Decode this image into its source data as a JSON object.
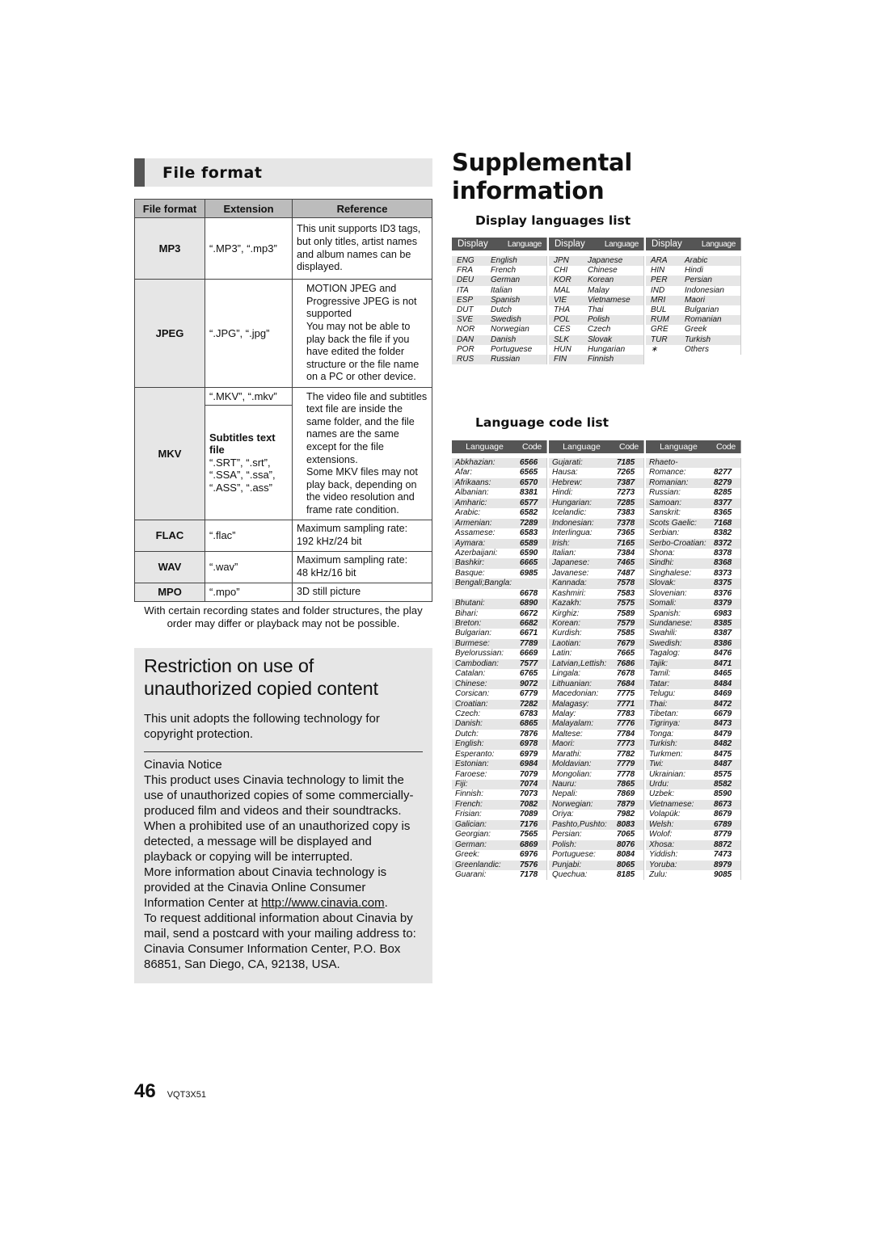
{
  "file_format": {
    "section_title": "File format",
    "headers": [
      "File format",
      "Extension",
      "Reference"
    ],
    "rows": [
      {
        "format": "MP3",
        "extension": "“.MP3”, “.mp3”",
        "reference": "This unit supports ID3 tags, but only titles, artist names and album names can be displayed."
      },
      {
        "format": "JPEG",
        "extension": "“.JPG”, “.jpg”",
        "reference": "MOTION JPEG and Progressive JPEG is not supported\nYou may not be able to play back the file if you have edited the folder structure or the file name on a PC or other device."
      },
      {
        "format": "MKV",
        "extension": "“.MKV”, “.mkv”",
        "subtitle_label": "Subtitles text file",
        "subtitle_extensions": "“.SRT”, “.srt”,\n“.SSA”, “.ssa”,\n“.ASS”, “.ass”",
        "reference": "The video file and subtitles text file are inside the same folder, and the file names are the same except for the file extensions.\nSome MKV files may not play back, depending on the video resolution and frame rate condition."
      },
      {
        "format": "FLAC",
        "extension": "“.flac”",
        "reference": "Maximum sampling rate:\n192 kHz/24 bit"
      },
      {
        "format": "WAV",
        "extension": "“.wav”",
        "reference": "Maximum sampling rate:\n48 kHz/16 bit"
      },
      {
        "format": "MPO",
        "extension": "“.mpo”",
        "reference": "3D still picture"
      }
    ],
    "note": "With certain recording states and folder structures, the play order may differ or playback may not be possible."
  },
  "restriction": {
    "title": "Restriction on use of unauthorized copied content",
    "intro": "This unit adopts the following technology for copyright protection.",
    "notice_heading": "Cinavia Notice",
    "body1": "This product uses Cinavia technology to limit the use of unauthorized copies of some commercially-produced film and videos and their soundtracks. When a prohibited use of an unauthorized copy is detected, a message will be displayed and playback or copying will be interrupted.",
    "body2_pre": "More information about Cinavia technology is provided at the Cinavia Online Consumer Information Center at ",
    "link": "http://www.cinavia.com",
    "body2_post": ".",
    "body3": "To request additional information about Cinavia by mail, send a postcard with your mailing address to:",
    "body4": "Cinavia Consumer Information Center, P.O. Box 86851, San Diego, CA, 92138, USA."
  },
  "supplemental": {
    "title": "Supplemental information",
    "display_languages": {
      "title": "Display languages list",
      "col_headers": [
        "Display",
        "Language"
      ],
      "columns": [
        [
          [
            "ENG",
            "English"
          ],
          [
            "FRA",
            "French"
          ],
          [
            "DEU",
            "German"
          ],
          [
            "ITA",
            "Italian"
          ],
          [
            "ESP",
            "Spanish"
          ],
          [
            "DUT",
            "Dutch"
          ],
          [
            "SVE",
            "Swedish"
          ],
          [
            "NOR",
            "Norwegian"
          ],
          [
            "DAN",
            "Danish"
          ],
          [
            "POR",
            "Portuguese"
          ],
          [
            "RUS",
            "Russian"
          ]
        ],
        [
          [
            "JPN",
            "Japanese"
          ],
          [
            "CHI",
            "Chinese"
          ],
          [
            "KOR",
            "Korean"
          ],
          [
            "MAL",
            "Malay"
          ],
          [
            "VIE",
            "Vietnamese"
          ],
          [
            "THA",
            "Thai"
          ],
          [
            "POL",
            "Polish"
          ],
          [
            "CES",
            "Czech"
          ],
          [
            "SLK",
            "Slovak"
          ],
          [
            "HUN",
            "Hungarian"
          ],
          [
            "FIN",
            "Finnish"
          ]
        ],
        [
          [
            "ARA",
            "Arabic"
          ],
          [
            "HIN",
            "Hindi"
          ],
          [
            "PER",
            "Persian"
          ],
          [
            "IND",
            "Indonesian"
          ],
          [
            "MRI",
            "Maori"
          ],
          [
            "BUL",
            "Bulgarian"
          ],
          [
            "RUM",
            "Romanian"
          ],
          [
            "GRE",
            "Greek"
          ],
          [
            "TUR",
            "Turkish"
          ],
          [
            "∗",
            "Others"
          ]
        ]
      ]
    },
    "language_codes": {
      "title": "Language code list",
      "col_headers": [
        "Language",
        "Code"
      ],
      "columns": [
        [
          [
            "Abkhazian:",
            "6566"
          ],
          [
            "Afar:",
            "6565"
          ],
          [
            "Afrikaans:",
            "6570"
          ],
          [
            "Albanian:",
            "8381"
          ],
          [
            "Amharic:",
            "6577"
          ],
          [
            "Arabic:",
            "6582"
          ],
          [
            "Armenian:",
            "7289"
          ],
          [
            "Assamese:",
            "6583"
          ],
          [
            "Aymara:",
            "6589"
          ],
          [
            "Azerbaijani:",
            "6590"
          ],
          [
            "Bashkir:",
            "6665"
          ],
          [
            "Basque:",
            "6985"
          ],
          [
            "Bengali;Bangla:",
            ""
          ],
          [
            "",
            "6678"
          ],
          [
            "Bhutani:",
            "6890"
          ],
          [
            "Bihari:",
            "6672"
          ],
          [
            "Breton:",
            "6682"
          ],
          [
            "Bulgarian:",
            "6671"
          ],
          [
            "Burmese:",
            "7789"
          ],
          [
            "Byelorussian:",
            "6669"
          ],
          [
            "Cambodian:",
            "7577"
          ],
          [
            "Catalan:",
            "6765"
          ],
          [
            "Chinese:",
            "9072"
          ],
          [
            "Corsican:",
            "6779"
          ],
          [
            "Croatian:",
            "7282"
          ],
          [
            "Czech:",
            "6783"
          ],
          [
            "Danish:",
            "6865"
          ],
          [
            "Dutch:",
            "7876"
          ],
          [
            "English:",
            "6978"
          ],
          [
            "Esperanto:",
            "6979"
          ],
          [
            "Estonian:",
            "6984"
          ],
          [
            "Faroese:",
            "7079"
          ],
          [
            "Fiji:",
            "7074"
          ],
          [
            "Finnish:",
            "7073"
          ],
          [
            "French:",
            "7082"
          ],
          [
            "Frisian:",
            "7089"
          ],
          [
            "Galician:",
            "7176"
          ],
          [
            "Georgian:",
            "7565"
          ],
          [
            "German:",
            "6869"
          ],
          [
            "Greek:",
            "6976"
          ],
          [
            "Greenlandic:",
            "7576"
          ],
          [
            "Guarani:",
            "7178"
          ]
        ],
        [
          [
            "Gujarati:",
            "7185"
          ],
          [
            "Hausa:",
            "7265"
          ],
          [
            "Hebrew:",
            "7387"
          ],
          [
            "Hindi:",
            "7273"
          ],
          [
            "Hungarian:",
            "7285"
          ],
          [
            "Icelandic:",
            "7383"
          ],
          [
            "Indonesian:",
            "7378"
          ],
          [
            "Interlingua:",
            "7365"
          ],
          [
            "Irish:",
            "7165"
          ],
          [
            "Italian:",
            "7384"
          ],
          [
            "Japanese:",
            "7465"
          ],
          [
            "Javanese:",
            "7487"
          ],
          [
            "Kannada:",
            "7578"
          ],
          [
            "Kashmiri:",
            "7583"
          ],
          [
            "Kazakh:",
            "7575"
          ],
          [
            "Kirghiz:",
            "7589"
          ],
          [
            "Korean:",
            "7579"
          ],
          [
            "Kurdish:",
            "7585"
          ],
          [
            "Laotian:",
            "7679"
          ],
          [
            "Latin:",
            "7665"
          ],
          [
            "Latvian,Lettish:",
            "7686"
          ],
          [
            "Lingala:",
            "7678"
          ],
          [
            "Lithuanian:",
            "7684"
          ],
          [
            "Macedonian:",
            "7775"
          ],
          [
            "Malagasy:",
            "7771"
          ],
          [
            "Malay:",
            "7783"
          ],
          [
            "Malayalam:",
            "7776"
          ],
          [
            "Maltese:",
            "7784"
          ],
          [
            "Maori:",
            "7773"
          ],
          [
            "Marathi:",
            "7782"
          ],
          [
            "Moldavian:",
            "7779"
          ],
          [
            "Mongolian:",
            "7778"
          ],
          [
            "Nauru:",
            "7865"
          ],
          [
            "Nepali:",
            "7869"
          ],
          [
            "Norwegian:",
            "7879"
          ],
          [
            "Oriya:",
            "7982"
          ],
          [
            "Pashto,Pushto:",
            "8083"
          ],
          [
            "Persian:",
            "7065"
          ],
          [
            "Polish:",
            "8076"
          ],
          [
            "Portuguese:",
            "8084"
          ],
          [
            "Punjabi:",
            "8065"
          ],
          [
            "Quechua:",
            "8185"
          ]
        ],
        [
          [
            "Rhaeto-Romance:",
            ""
          ],
          [
            "",
            "8277"
          ],
          [
            "Romanian:",
            "8279"
          ],
          [
            "Russian:",
            "8285"
          ],
          [
            "Samoan:",
            "8377"
          ],
          [
            "Sanskrit:",
            "8365"
          ],
          [
            "Scots Gaelic:",
            "7168"
          ],
          [
            "Serbian:",
            "8382"
          ],
          [
            "Serbo-Croatian:",
            "8372"
          ],
          [
            "Shona:",
            "8378"
          ],
          [
            "Sindhi:",
            "8368"
          ],
          [
            "Singhalese:",
            "8373"
          ],
          [
            "Slovak:",
            "8375"
          ],
          [
            "Slovenian:",
            "8376"
          ],
          [
            "Somali:",
            "8379"
          ],
          [
            "Spanish:",
            "6983"
          ],
          [
            "Sundanese:",
            "8385"
          ],
          [
            "Swahili:",
            "8387"
          ],
          [
            "Swedish:",
            "8386"
          ],
          [
            "Tagalog:",
            "8476"
          ],
          [
            "Tajik:",
            "8471"
          ],
          [
            "Tamil:",
            "8465"
          ],
          [
            "Tatar:",
            "8484"
          ],
          [
            "Telugu:",
            "8469"
          ],
          [
            "Thai:",
            "8472"
          ],
          [
            "Tibetan:",
            "6679"
          ],
          [
            "Tigrinya:",
            "8473"
          ],
          [
            "Tonga:",
            "8479"
          ],
          [
            "Turkish:",
            "8482"
          ],
          [
            "Turkmen:",
            "8475"
          ],
          [
            "Twi:",
            "8487"
          ],
          [
            "Ukrainian:",
            "8575"
          ],
          [
            "Urdu:",
            "8582"
          ],
          [
            "Uzbek:",
            "8590"
          ],
          [
            "Vietnamese:",
            "8673"
          ],
          [
            "Volapük:",
            "8679"
          ],
          [
            "Welsh:",
            "6789"
          ],
          [
            "Wolof:",
            "8779"
          ],
          [
            "Xhosa:",
            "8872"
          ],
          [
            "Yiddish:",
            "7473"
          ],
          [
            "Yoruba:",
            "8979"
          ],
          [
            "Zulu:",
            "9085"
          ]
        ]
      ]
    }
  },
  "footer": {
    "page_number": "46",
    "doc_code": "VQT3X51"
  }
}
